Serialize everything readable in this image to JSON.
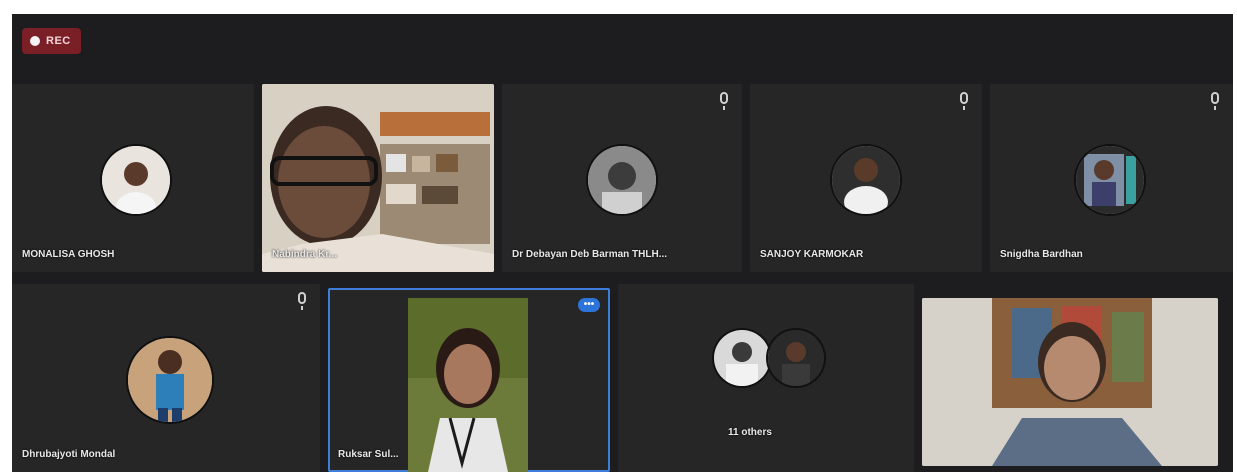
{
  "recording": {
    "label": "REC"
  },
  "row1": [
    {
      "name": "MONALISA GHOSH"
    },
    {
      "name": "Nabindra Kr..."
    },
    {
      "name": "Dr Debayan Deb Barman THLH..."
    },
    {
      "name": "SANJOY KARMOKAR"
    },
    {
      "name": "Snigdha Bardhan"
    }
  ],
  "row2": [
    {
      "name": "Dhrubajyoti Mondal"
    },
    {
      "name": "Ruksar Sul..."
    },
    {
      "name": "11 others"
    },
    {
      "name": ""
    }
  ],
  "more_options": {
    "label": "•••"
  },
  "colors": {
    "highlight": "#3f7ed8",
    "rec": "#7b1f26",
    "tile": "#262626"
  }
}
